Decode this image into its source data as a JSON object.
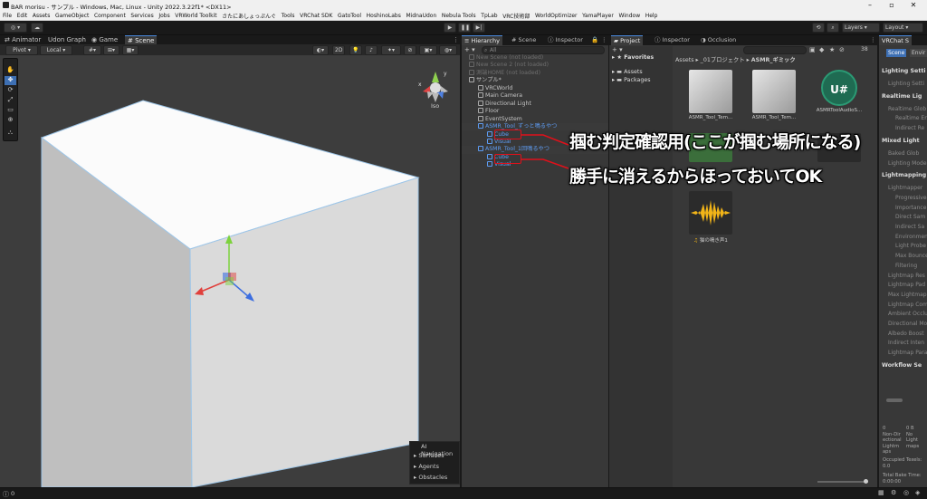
{
  "window": {
    "title": "BAR morisu - サンプル - Windows, Mac, Linux - Unity 2022.3.22f1* <DX11>"
  },
  "menu": [
    "File",
    "Edit",
    "Assets",
    "GameObject",
    "Component",
    "Services",
    "Jobs",
    "VRWorld Toolkit",
    "さたにあしょっぷんぐ",
    "Tools",
    "VRChat SDK",
    "GatoTool",
    "HoshinoLabs",
    "MidnaUdon",
    "Nebula Tools",
    "TpLab",
    "VRC技術部",
    "WorldOptimizer",
    "YamaPlayer",
    "Window",
    "Help"
  ],
  "toolbar": {
    "account": "◎ ▾",
    "layers": "Layers",
    "layout": "Layout"
  },
  "scene_tabs": [
    "Animator",
    "Udon Graph",
    "Game",
    "Scene"
  ],
  "scene_toolbar": {
    "pivot": "Pivot",
    "local": "Local",
    "mode_2d": "2D"
  },
  "gizmo": {
    "projection": "Iso"
  },
  "ai_navigation": {
    "title": "AI Navigation",
    "items": [
      "Surfaces",
      "Agents",
      "Obstacles"
    ]
  },
  "hierarchy": {
    "tabs": [
      "Hierarchy",
      "Scene",
      "Inspector"
    ],
    "search_placeholder": "All",
    "rows": [
      {
        "label": "New Scene (not loaded)",
        "dim": true,
        "indent": 0
      },
      {
        "label": "New Scene 2 (not loaded)",
        "dim": true,
        "indent": 0
      },
      {
        "label": "測端HOME (not loaded)",
        "dim": true,
        "indent": 0
      },
      {
        "label": "サンプル*",
        "dim": false,
        "indent": 0
      },
      {
        "label": "VRCWorld",
        "indent": 1
      },
      {
        "label": "Main Camera",
        "indent": 1
      },
      {
        "label": "Directional Light",
        "indent": 1
      },
      {
        "label": "Floor",
        "indent": 1
      },
      {
        "label": "EventSystem",
        "indent": 1
      },
      {
        "label": "ASMR_Tool_ずっと鳴るやつ",
        "indent": 1,
        "blue": true
      },
      {
        "label": "Cube",
        "indent": 2,
        "blue": true
      },
      {
        "label": "Visual",
        "indent": 2,
        "blue": true
      },
      {
        "label": "ASMR_Tool_1回鳴るやつ",
        "indent": 1,
        "blue": true
      },
      {
        "label": "Cube",
        "indent": 2,
        "blue": true
      },
      {
        "label": "Visual",
        "indent": 2,
        "blue": true
      }
    ]
  },
  "annotations": {
    "line1": "掴む判定確認用(ここが掴む場所になる)",
    "line2": "勝手に消えるからほっておいてOK"
  },
  "project": {
    "tabs": [
      "Project",
      "Inspector",
      "Occlusion"
    ],
    "favorites": "Favorites",
    "tree": [
      "Assets",
      "Packages"
    ],
    "breadcrumb": [
      "Assets",
      "_01プロジェクト",
      "ASMR_ギミック"
    ],
    "assets": [
      {
        "name": "ASMR_Tool_Tem...",
        "kind": "prefab"
      },
      {
        "name": "ASMR_Tool_Tem...",
        "kind": "prefab"
      },
      {
        "name": "ASMRToolAudioS...",
        "kind": "udon"
      },
      {
        "name": "",
        "kind": "prefab-green"
      },
      {
        "name": "",
        "kind": "audio-partial"
      },
      {
        "name": "猫の鳴き声1",
        "kind": "audio"
      }
    ],
    "count": "38"
  },
  "right_panel": {
    "tab": "VRChat S",
    "subtabs": [
      "Scene",
      "Envir"
    ],
    "sections": [
      {
        "label": "Lighting Setti",
        "type": "section"
      },
      {
        "label": "Lighting Setti",
        "type": "row"
      },
      {
        "label": "Realtime Lig",
        "type": "section"
      },
      {
        "label": "Realtime Glob",
        "type": "row"
      },
      {
        "label": "Realtime En",
        "type": "row2"
      },
      {
        "label": "Indirect Re",
        "type": "row2"
      },
      {
        "label": "Mixed Light",
        "type": "section"
      },
      {
        "label": "Baked Glob",
        "type": "row"
      },
      {
        "label": "Lighting Mode",
        "type": "row"
      },
      {
        "label": "Lightmapping",
        "type": "section"
      },
      {
        "label": "Lightmapper",
        "type": "row"
      },
      {
        "label": "Progressive",
        "type": "row2"
      },
      {
        "label": "Importance",
        "type": "row2"
      },
      {
        "label": "Direct Sam",
        "type": "row2"
      },
      {
        "label": "Indirect Sa",
        "type": "row2"
      },
      {
        "label": "Environmen",
        "type": "row2"
      },
      {
        "label": "Light Probe",
        "type": "row2"
      },
      {
        "label": "Max Bounce",
        "type": "row2"
      },
      {
        "label": "Filtering",
        "type": "row2"
      },
      {
        "label": "Lightmap Res",
        "type": "row"
      },
      {
        "label": "Lightmap Pad",
        "type": "row"
      },
      {
        "label": "Max Lightmap",
        "type": "row"
      },
      {
        "label": "Lightmap Com",
        "type": "row"
      },
      {
        "label": "Ambient Occlu",
        "type": "row"
      },
      {
        "label": "Directional Mo",
        "type": "row"
      },
      {
        "label": "Albedo Boost",
        "type": "row"
      },
      {
        "label": "Indirect Inten",
        "type": "row"
      },
      {
        "label": "Lightmap Para",
        "type": "row"
      },
      {
        "label": "Workflow Se",
        "type": "section"
      }
    ],
    "stats": {
      "col1": [
        "0",
        "Non-Dir",
        "ectional",
        "Lightm",
        "aps"
      ],
      "col2": [
        "0 B",
        "No",
        "Light",
        "maps"
      ],
      "occupied": "Occupied Texels: 0.0",
      "total": "Total Bake Time: 0:00:00"
    }
  },
  "status": {
    "left": "0"
  }
}
